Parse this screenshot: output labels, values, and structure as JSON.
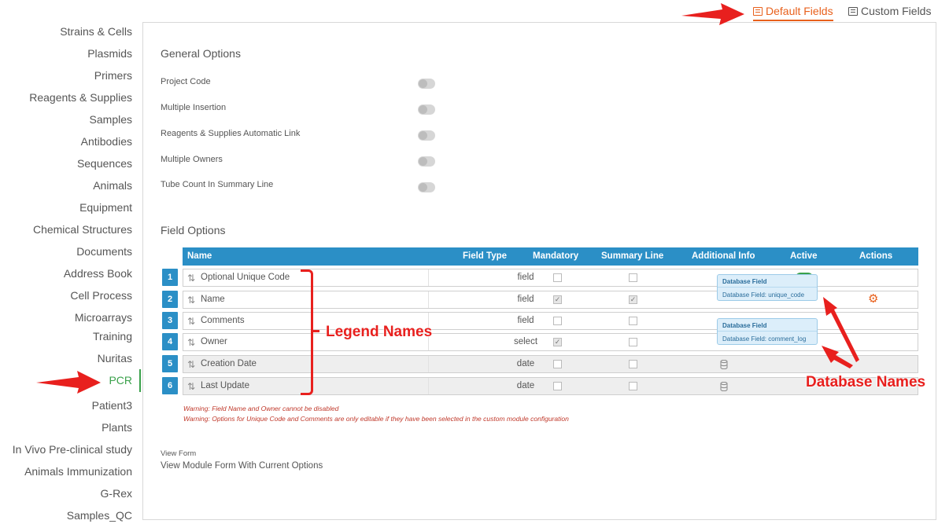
{
  "sidebar": {
    "items": [
      {
        "label": "Strains & Cells"
      },
      {
        "label": "Plasmids"
      },
      {
        "label": "Primers"
      },
      {
        "label": "Reagents & Supplies"
      },
      {
        "label": "Samples"
      },
      {
        "label": "Antibodies"
      },
      {
        "label": "Sequences"
      },
      {
        "label": "Animals"
      },
      {
        "label": "Equipment"
      },
      {
        "label": "Chemical Structures"
      },
      {
        "label": "Documents"
      },
      {
        "label": "Address Book"
      },
      {
        "label": "Cell Process"
      },
      {
        "label": "Microarrays"
      },
      {
        "label": "Training"
      },
      {
        "label": "Nuritas"
      },
      {
        "label": "PCR",
        "active": true
      },
      {
        "label": "Patient3"
      },
      {
        "label": "Plants"
      },
      {
        "label": "In Vivo Pre-clinical study"
      },
      {
        "label": "Animals Immunization"
      },
      {
        "label": "G-Rex"
      },
      {
        "label": "Samples_QC"
      }
    ]
  },
  "tabs": {
    "default_fields": "Default Fields",
    "custom_fields": "Custom Fields"
  },
  "general": {
    "title": "General Options",
    "options": [
      {
        "label": "Project Code",
        "enabled": false
      },
      {
        "label": "Multiple Insertion",
        "enabled": false
      },
      {
        "label": "Reagents & Supplies Automatic Link",
        "enabled": false
      },
      {
        "label": "Multiple Owners",
        "enabled": false
      },
      {
        "label": "Tube Count In Summary Line",
        "enabled": false
      }
    ]
  },
  "fields": {
    "title": "Field Options",
    "columns": {
      "name": "Name",
      "field_type": "Field Type",
      "mandatory": "Mandatory",
      "summary_line": "Summary Line",
      "additional_info": "Additional Info",
      "active": "Active",
      "actions": "Actions"
    },
    "rows": [
      {
        "num": "1",
        "name": "Optional Unique Code",
        "type": "field",
        "mandatory": false,
        "summary": false
      },
      {
        "num": "2",
        "name": "Name",
        "type": "field",
        "mandatory": true,
        "summary": true
      },
      {
        "num": "3",
        "name": "Comments",
        "type": "field",
        "mandatory": false,
        "summary": false
      },
      {
        "num": "4",
        "name": "Owner",
        "type": "select",
        "mandatory": true,
        "summary": false
      },
      {
        "num": "5",
        "name": "Creation Date",
        "type": "date",
        "mandatory": false,
        "summary": false
      },
      {
        "num": "6",
        "name": "Last Update",
        "type": "date",
        "mandatory": false,
        "summary": false
      }
    ],
    "tooltips": [
      {
        "head": "Database Field",
        "body": "Database Field: unique_code"
      },
      {
        "head": "Database Field",
        "body": "Database Field: comment_log"
      }
    ]
  },
  "warnings": [
    "Warning: Field Name and Owner cannot be disabled",
    "Warning: Options for Unique Code and Comments are only editable if they have been selected in the custom module configuration"
  ],
  "view_form": {
    "label": "View Form",
    "link": "View Module Form With Current Options"
  },
  "annotations": {
    "legend_names": "Legend Names",
    "database_names": "Database Names"
  },
  "colors": {
    "accent": "#e8601c",
    "primary": "#2b8fc6",
    "active": "#3aa14b",
    "annotation": "#e8201e"
  },
  "icons": [
    "list-icon",
    "sort-icon",
    "database-icon",
    "gear-icon",
    "arrow-icon"
  ]
}
